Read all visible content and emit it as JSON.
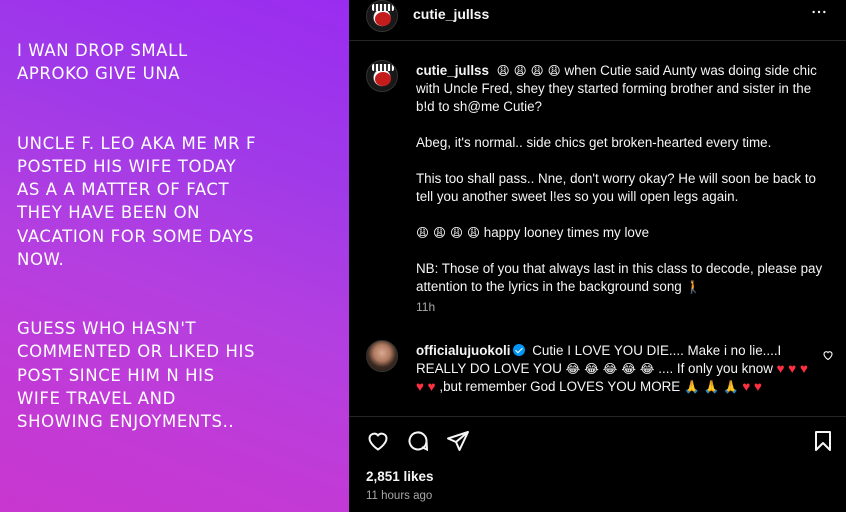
{
  "media": {
    "paragraphs": [
      "I WAN DROP SMALL\nAPROKO GIVE UNA",
      "UNCLE F. LEO AKA ME MR F\nPOSTED HIS WIFE TODAY\nAS A A MATTER OF FACT\nTHEY HAVE BEEN ON\nVACATION FOR SOME DAYS\nNOW.",
      "GUESS WHO HASN'T\nCOMMENTED OR LIKED HIS\nPOST SINCE HIM N HIS\nWIFE TRAVEL AND\nSHOWING ENJOYMENTS.."
    ]
  },
  "header": {
    "username": "cutie_jullss",
    "more_icon": "more-horizontal-icon"
  },
  "caption": {
    "username": "cutie_jullss",
    "emoji_lead": "😩 😩 😩 😩",
    "line1": "when Cutie said Aunty was doing side chic with Uncle Fred, shey they started forming brother and sister in the b!d to sh@me Cutie?",
    "p2": "Abeg, it's normal.. side chics get broken-hearted every time.",
    "p3": "This too shall pass.. Nne, don't worry okay? He will soon be back to tell you another sweet l!es so you will open legs again.",
    "p4_emoji": "😩 😩 😩 😩",
    "p4_text": "happy looney times my love",
    "p5": "NB: Those of you that always last in this class to decode, please pay attention to the lyrics in the background song",
    "p5_emoji": "🚶",
    "time": "11h"
  },
  "comment": {
    "username": "officialujuokoli",
    "text_a": "Cutie I LOVE YOU DIE.... Make i no lie....I REALLY DO LOVE YOU",
    "emoji_a": "😂 😂 😂 😂 😂",
    "text_b": ".... If only you know",
    "hearts_a": "♥ ♥ ♥ ♥ ♥",
    "text_c": ",but remember God LOVES YOU MORE",
    "pray": "🙏 🙏 🙏",
    "hearts_b": "♥ ♥"
  },
  "actions": {
    "icons": [
      "heart-icon",
      "comment-icon",
      "share-icon",
      "bookmark-icon"
    ]
  },
  "likes": "2,851 likes",
  "posted_ago": "11 hours ago"
}
